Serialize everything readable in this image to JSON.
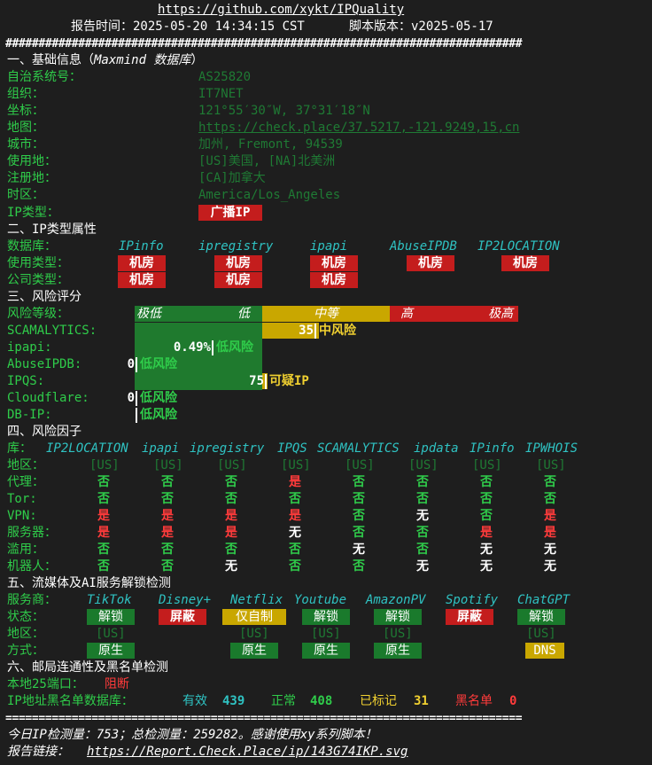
{
  "header": {
    "url": "https://github.com/xykt/IPQuality",
    "report_time_label": "报告时间：2025-05-20 14:34:15 CST",
    "version_label": "脚本版本：v2025-05-17"
  },
  "hashline": "##############################################################################",
  "eqline": "==============================================================================",
  "sec1": {
    "title": "一、基础信息（",
    "title_italic": "Maxmind 数据库",
    "title_end": "）",
    "rows": [
      {
        "label": "自治系统号：",
        "value": "AS25820"
      },
      {
        "label": "组织：",
        "value": "IT7NET"
      },
      {
        "label": "坐标：",
        "value": "121°55′30″W, 37°31′18″N"
      },
      {
        "label": "地图：",
        "value": "https://check.place/37.5217,-121.9249,15,cn"
      },
      {
        "label": "城市：",
        "value": "加州, Fremont, 94539"
      },
      {
        "label": "使用地：",
        "value": "[US]美国, [NA]北美洲"
      },
      {
        "label": "注册地：",
        "value": "[CA]加拿大"
      },
      {
        "label": "时区：",
        "value": "America/Los_Angeles"
      }
    ],
    "iptype_label": "IP类型：",
    "iptype_value": "广播IP"
  },
  "sec2": {
    "title": "二、IP类型属性",
    "db_label": "数据库：",
    "dbs": [
      "IPinfo",
      "ipregistry",
      "ipapi",
      "AbuseIPDB",
      "IP2LOCATION"
    ],
    "usage_label": "使用类型：",
    "usage": [
      "机房",
      "机房",
      "机房",
      "机房",
      "机房"
    ],
    "company_label": "公司类型：",
    "company": [
      "机房",
      "机房",
      "机房"
    ]
  },
  "sec3": {
    "title": "三、风险评分",
    "level_label": "风险等级：",
    "levels": [
      "极低",
      "低",
      "中等",
      "高",
      "极高"
    ],
    "rows": [
      {
        "label": "SCAMALYTICS:",
        "score": "35",
        "risk": "中风险",
        "level": 0.35
      },
      {
        "label": "ipapi:",
        "score": "0.49%",
        "risk": "低风险",
        "level": 0.0049
      },
      {
        "label": "AbuseIPDB:",
        "score": "0",
        "risk": "低风险",
        "level": 0
      },
      {
        "label": "IPQS:",
        "score": "75",
        "risk": "可疑IP",
        "level": 0.75
      },
      {
        "label": "Cloudflare:",
        "score": "0",
        "risk": "低风险",
        "level": 0
      },
      {
        "label": "DB-IP:",
        "score": "",
        "risk": "低风险",
        "level": 0
      }
    ]
  },
  "sec4": {
    "title": "四、风险因子",
    "lib_label": "库：",
    "libs": [
      "IP2LOCATION",
      "ipapi",
      "ipregistry",
      "IPQS",
      "SCAMALYTICS",
      "ipdata",
      "IPinfo",
      "IPWHOIS"
    ],
    "rows": [
      {
        "label": "地区：",
        "vals": [
          "[US]",
          "[US]",
          "[US]",
          "[US]",
          "[US]",
          "[US]",
          "[US]",
          "[US]"
        ]
      },
      {
        "label": "代理：",
        "vals": [
          "否",
          "否",
          "否",
          "是",
          "否",
          "否",
          "否",
          "否"
        ]
      },
      {
        "label": "Tor:",
        "vals": [
          "否",
          "否",
          "否",
          "否",
          "否",
          "否",
          "否",
          "否"
        ]
      },
      {
        "label": "VPN:",
        "vals": [
          "是",
          "是",
          "是",
          "是",
          "否",
          "无",
          "否",
          "是"
        ]
      },
      {
        "label": "服务器：",
        "vals": [
          "是",
          "是",
          "是",
          "无",
          "否",
          "否",
          "是",
          "是"
        ]
      },
      {
        "label": "滥用：",
        "vals": [
          "否",
          "否",
          "否",
          "否",
          "无",
          "否",
          "无",
          "无"
        ]
      },
      {
        "label": "机器人：",
        "vals": [
          "否",
          "否",
          "无",
          "否",
          "否",
          "无",
          "无",
          "无"
        ]
      }
    ]
  },
  "sec5": {
    "title": "五、流媒体及AI服务解锁检测",
    "svc_label": "服务商：",
    "services": [
      "TikTok",
      "Disney+",
      "Netflix",
      "Youtube",
      "AmazonPV",
      "Spotify",
      "ChatGPT"
    ],
    "status_label": "状态：",
    "status": [
      "解锁",
      "屏蔽",
      "仅自制",
      "解锁",
      "解锁",
      "屏蔽",
      "解锁"
    ],
    "region_label": "地区：",
    "regions": [
      "[US]",
      "",
      "[US]",
      "[US]",
      "[US]",
      "",
      "[US]"
    ],
    "method_label": "方式：",
    "methods": [
      "原生",
      "",
      "原生",
      "原生",
      "原生",
      "",
      "DNS"
    ]
  },
  "sec6": {
    "title": "六、邮局连通性及黑名单检测",
    "port_label": "本地25端口：",
    "port_value": "阻断",
    "bl_label": "IP地址黑名单数据库：",
    "valid_label": "有效",
    "valid": "439",
    "normal_label": "正常",
    "normal": "408",
    "marked_label": "已标记",
    "marked": "31",
    "black_label": "黑名单",
    "black": "0"
  },
  "footer": {
    "stats": "今日IP检测量：753；总检测量：259282。感谢使用xy系列脚本！",
    "link_label": "报告链接：",
    "link": "https://Report.Check.Place/ip/143G74IKP.svg"
  }
}
